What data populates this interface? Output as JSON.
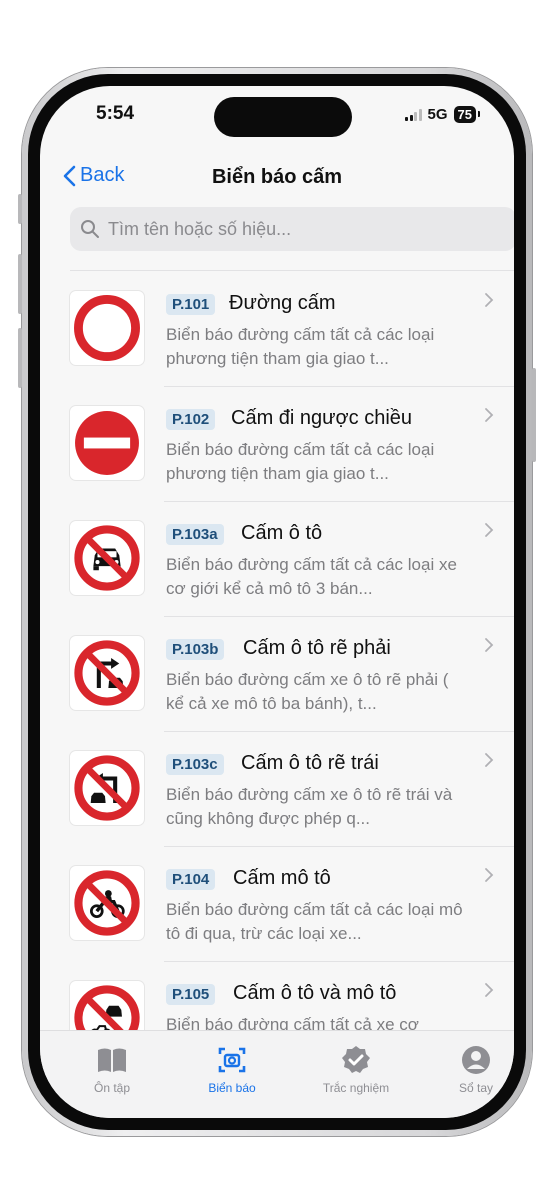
{
  "status": {
    "time": "5:54",
    "network": "5G",
    "battery": "75"
  },
  "nav": {
    "back_label": "Back",
    "title": "Biển báo cấm"
  },
  "search": {
    "placeholder": "Tìm tên hoặc số hiệu..."
  },
  "signs": [
    {
      "code": "P.101",
      "name": "Đường cấm",
      "desc": "Biển báo đường cấm tất cả các loại phương tiện tham gia giao t...",
      "icon": "no-entry-all-icon"
    },
    {
      "code": "P.102",
      "name": "Cấm đi ngược chiều",
      "desc": "Biển báo đường cấm tất cả các loại phương tiện tham gia giao t...",
      "icon": "no-entry-icon"
    },
    {
      "code": "P.103a",
      "name": "Cấm ô tô",
      "desc": "Biển báo đường cấm tất cả các loại xe cơ giới kể cả mô tô 3 bán...",
      "icon": "no-car-icon"
    },
    {
      "code": "P.103b",
      "name": "Cấm ô tô rẽ phải",
      "desc": "Biển báo đường cấm xe ô tô rẽ phải ( kể cả xe mô tô ba bánh), t...",
      "icon": "no-car-right-turn-icon"
    },
    {
      "code": "P.103c",
      "name": "Cấm ô tô rẽ trái",
      "desc": "Biển báo đường cấm xe ô tô rẽ trái và cũng không được phép q...",
      "icon": "no-car-left-turn-icon"
    },
    {
      "code": "P.104",
      "name": "Cấm mô tô",
      "desc": "Biển báo đường cấm tất cả các loại mô tô đi qua, trừ các loại xe...",
      "icon": "no-motorbike-icon"
    },
    {
      "code": "P.105",
      "name": "Cấm ô tô và mô tô",
      "desc": "Biển báo đường cấm tất cả xe cơ",
      "icon": "no-car-and-motorbike-icon"
    }
  ],
  "tabs": [
    {
      "label": "Ôn tập",
      "icon": "book-icon",
      "active": false
    },
    {
      "label": "Biển báo",
      "icon": "camera-icon",
      "active": true
    },
    {
      "label": "Trắc nghiệm",
      "icon": "checkmark-badge-icon",
      "active": false
    },
    {
      "label": "Sổ tay",
      "icon": "person-icon",
      "active": false
    }
  ],
  "colors": {
    "accent": "#1a73e8",
    "sign_red": "#d9262c",
    "code_bg": "#dbe7f1"
  }
}
